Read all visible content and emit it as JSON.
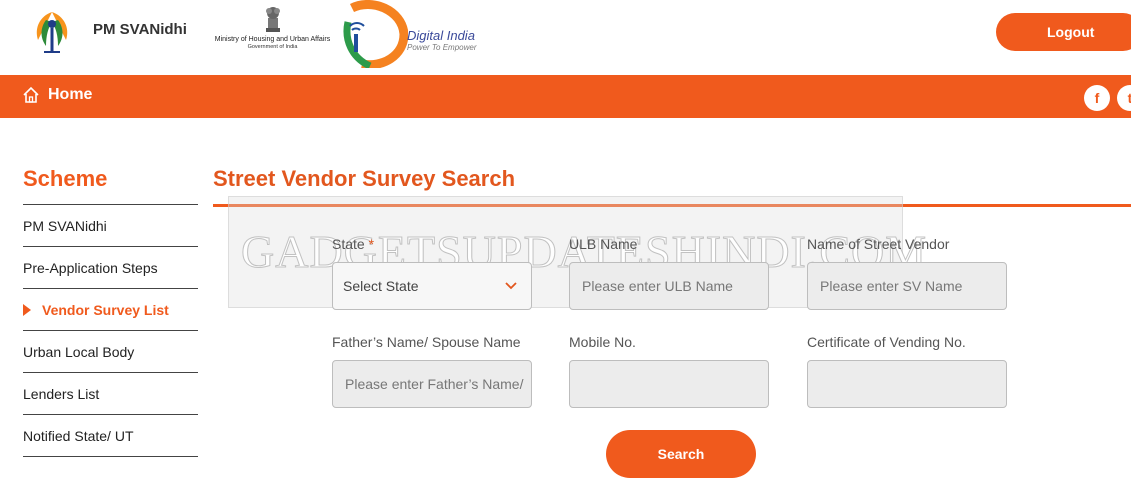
{
  "header": {
    "brand_title": "PM SVANidhi",
    "ministry_line1": "Ministry of Housing and Urban Affairs",
    "ministry_line2": "Government of India",
    "digital_india_title": "Digital India",
    "digital_india_tagline": "Power To Empower",
    "logout_label": "Logout"
  },
  "nav": {
    "home_label": "Home",
    "facebook_glyph": "f",
    "twitter_glyph": "t"
  },
  "sidebar": {
    "title": "Scheme",
    "items": [
      {
        "label": "PM SVANidhi",
        "active": false
      },
      {
        "label": "Pre-Application Steps",
        "active": false
      },
      {
        "label": "Vendor Survey List",
        "active": true
      },
      {
        "label": "Urban Local Body",
        "active": false
      },
      {
        "label": "Lenders List",
        "active": false
      },
      {
        "label": "Notified State/ UT",
        "active": false
      }
    ]
  },
  "main": {
    "title": "Street Vendor Survey Search",
    "watermark": "GADGETSUPDATESHINDI.COM",
    "fields": {
      "state": {
        "label": "State",
        "required_mark": "*",
        "value": "Select State"
      },
      "ulb": {
        "label": "ULB Name",
        "placeholder": "Please enter ULB Name"
      },
      "vendor": {
        "label": "Name of Street Vendor",
        "placeholder": "Please enter SV Name"
      },
      "father": {
        "label": "Father’s Name/ Spouse Name",
        "placeholder": "Please enter Father’s Name/"
      },
      "mobile": {
        "label": "Mobile No.",
        "placeholder": ""
      },
      "cov": {
        "label": "Certificate of Vending No.",
        "placeholder": ""
      }
    },
    "search_label": "Search"
  },
  "colors": {
    "accent": "#f05a1d",
    "title": "#e2571e",
    "field_bg": "#ececec"
  },
  "icons": {
    "home": "home-icon",
    "dropdown": "chevron-down-icon",
    "facebook": "facebook-icon",
    "twitter": "twitter-icon"
  }
}
